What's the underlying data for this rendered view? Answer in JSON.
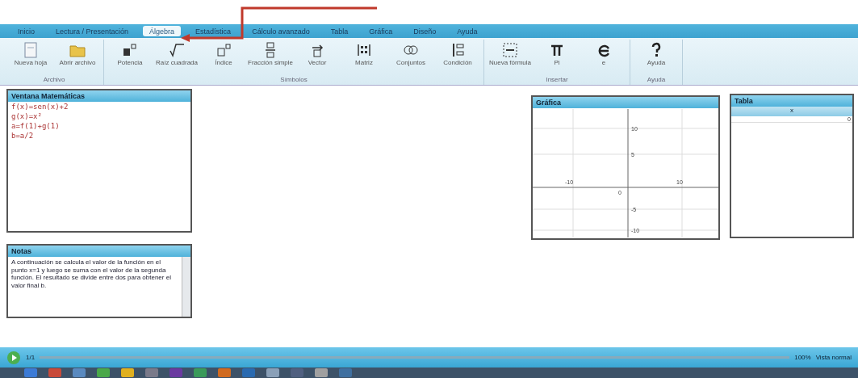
{
  "tabs": [
    {
      "label": "Inicio",
      "selected": false
    },
    {
      "label": "Lectura / Presentación",
      "selected": false
    },
    {
      "label": "Álgebra",
      "selected": true
    },
    {
      "label": "Estadística",
      "selected": false
    },
    {
      "label": "Cálculo avanzado",
      "selected": false
    },
    {
      "label": "Tabla",
      "selected": false
    },
    {
      "label": "Gráfica",
      "selected": false
    },
    {
      "label": "Diseño",
      "selected": false
    },
    {
      "label": "Ayuda",
      "selected": false
    }
  ],
  "ribbon_groups": [
    {
      "label": "Archivo",
      "buttons": [
        "Nueva hoja",
        "Abrir archivo"
      ]
    },
    {
      "label": "Símbolos",
      "buttons": [
        "Potencia",
        "Raíz cuadrada",
        "Índice",
        "Fracción simple",
        "Vector",
        "Matriz",
        "Conjuntos",
        "Condición"
      ]
    },
    {
      "label": "Insertar",
      "buttons": [
        "Nueva fórmula",
        "Pi",
        "e"
      ]
    },
    {
      "label": "Ayuda",
      "buttons": [
        "Ayuda"
      ]
    }
  ],
  "math_panel": {
    "title": "Ventana Matemáticas",
    "lines": [
      "f(x)=sen(x)+2",
      "g(x)=x²",
      "a=f(1)+g(1)",
      "b=a/2"
    ]
  },
  "notes_panel": {
    "title": "Notas",
    "text": "A continuación se calcula el valor de la función en el punto x=1 y luego se suma con el valor de la segunda función. El resultado se divide entre dos para obtener el valor final b."
  },
  "graph_panel": {
    "title": "Gráfica",
    "x_labels": [
      "-10",
      "10"
    ],
    "y_labels": [
      "10",
      "5",
      "-5",
      "-10"
    ],
    "origin": "0"
  },
  "table_panel": {
    "title": "Tabla",
    "column": "x",
    "cell": "0"
  },
  "status_bar": {
    "page": "1/1",
    "zoom": "100%",
    "view": "Vista normal"
  }
}
